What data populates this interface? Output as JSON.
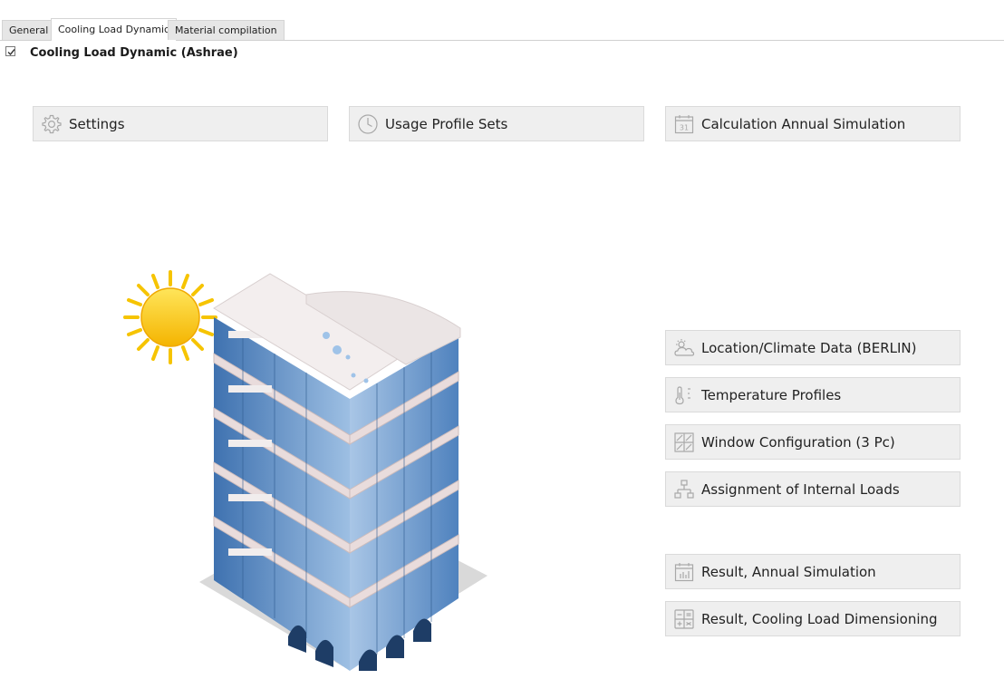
{
  "tabs": [
    {
      "label": "General",
      "active": false
    },
    {
      "label": "Cooling Load Dynamic",
      "active": true
    },
    {
      "label": "Material compilation",
      "active": false
    }
  ],
  "section": {
    "enabled": true,
    "title": "Cooling Load Dynamic (Ashrae)"
  },
  "top_buttons": {
    "settings": {
      "label": "Settings",
      "icon": "gear-icon"
    },
    "usage_profiles": {
      "label": "Usage Profile Sets",
      "icon": "clock-icon"
    },
    "annual_simulation": {
      "label": "Calculation Annual Simulation",
      "icon": "calendar-icon",
      "icon_text": "31"
    }
  },
  "side_buttons": {
    "location": {
      "label": "Location/Climate Data (BERLIN)",
      "icon": "weather-cloud-icon"
    },
    "temperature": {
      "label": "Temperature Profiles",
      "icon": "thermometer-icon"
    },
    "windows": {
      "label": "Window Configuration (3 Pc)",
      "icon": "window-icon"
    },
    "internal_loads": {
      "label": "Assignment of Internal Loads",
      "icon": "hierarchy-icon"
    },
    "result_annual": {
      "label": "Result, Annual Simulation",
      "icon": "chart-calendar-icon"
    },
    "result_cooling": {
      "label": "Result, Cooling Load Dimensioning",
      "icon": "calculator-icon"
    }
  },
  "colors": {
    "button_bg": "#efefef",
    "button_border": "#dadada",
    "icon_stroke": "#a8a8a8",
    "sun": "#f7c300",
    "glass": "#5b8fc9"
  }
}
